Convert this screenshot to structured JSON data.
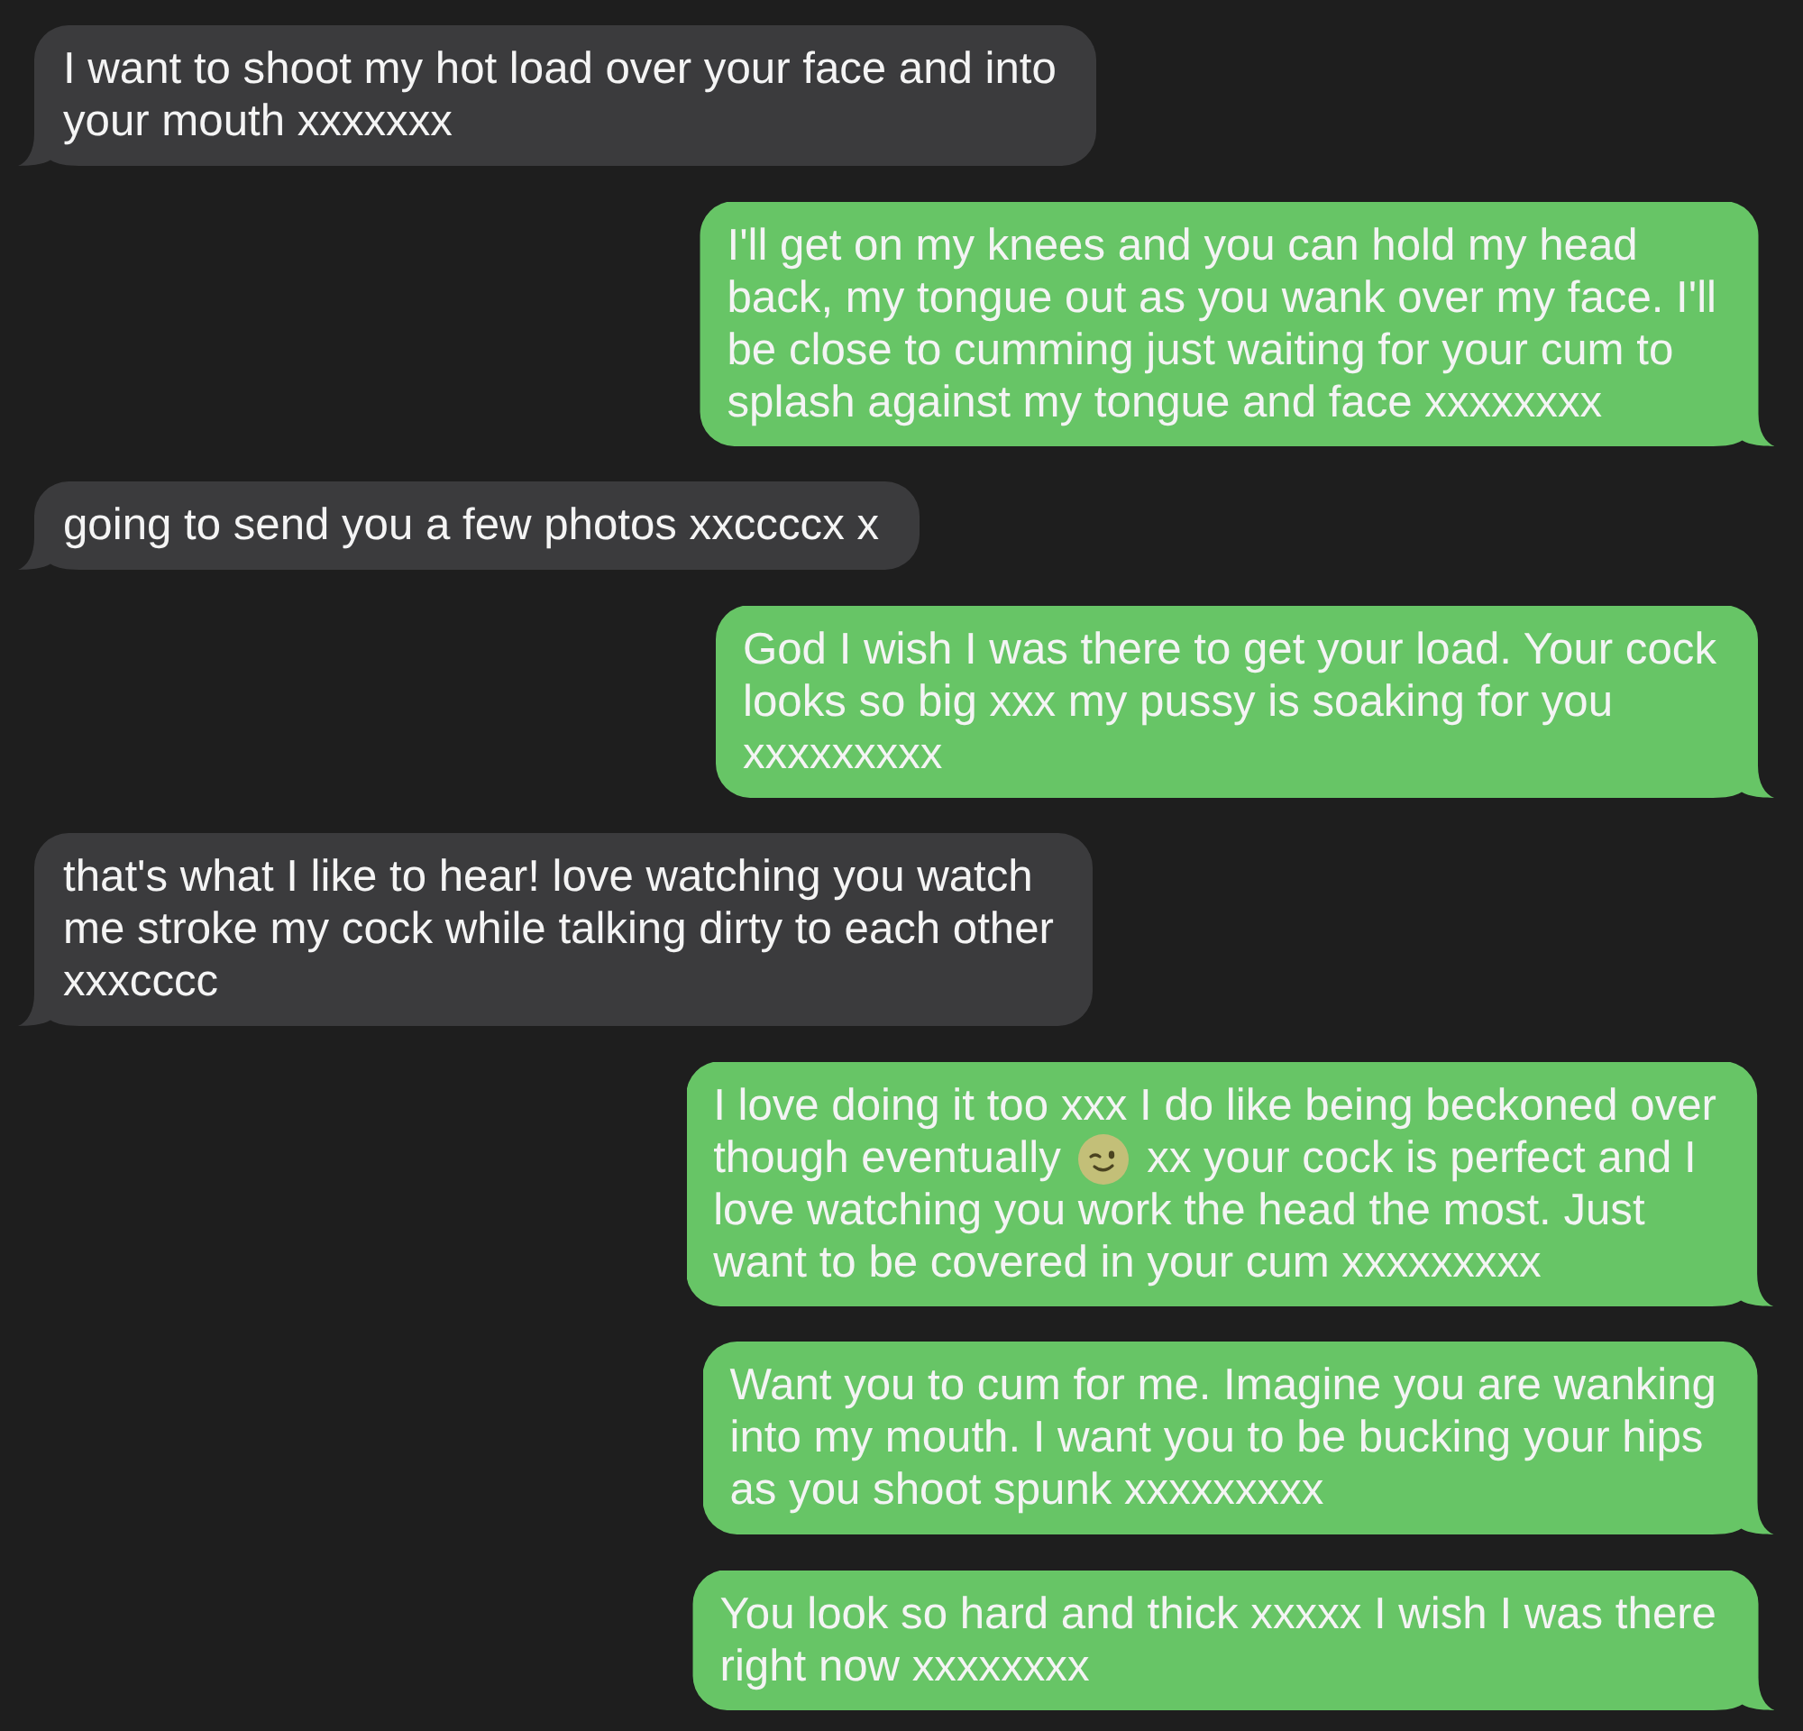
{
  "messages": [
    {
      "kind": "incoming",
      "parts": [
        {
          "kind": "text",
          "text": "I want to shoot my hot load over your face and into\nyour mouth xxxxxxx"
        }
      ]
    },
    {
      "kind": "outgoing",
      "parts": [
        {
          "kind": "text",
          "text": "I'll get on my knees and you can hold my head\nback, my tongue out as you wank over my face. I'll\nbe close to cumming just waiting for your cum to\nsplash against my tongue and face xxxxxxxx"
        }
      ]
    },
    {
      "kind": "incoming",
      "parts": [
        {
          "kind": "text",
          "text": "going to send you a few photos xxccccx x"
        }
      ]
    },
    {
      "kind": "outgoing",
      "parts": [
        {
          "kind": "text",
          "text": "God I wish I was there to get your load. Your cock\nlooks so big xxx my pussy is soaking for you\nxxxxxxxxx"
        }
      ]
    },
    {
      "kind": "incoming",
      "parts": [
        {
          "kind": "text",
          "text": "that's what I like to hear! love watching you watch\nme stroke my cock while talking dirty to each other\nxxxcccc"
        }
      ]
    },
    {
      "kind": "outgoing",
      "parts": [
        {
          "kind": "text",
          "text": "I love doing it too xxx I do like being beckoned over\nthough eventually"
        },
        {
          "kind": "emoji"
        },
        {
          "kind": "text",
          "text": "xx your cock is perfect and I\nlove watching you work the head the most. Just\nwant to be covered in your cum xxxxxxxxx"
        }
      ]
    },
    {
      "kind": "outgoing",
      "parts": [
        {
          "kind": "text",
          "text": "Want you to cum for me. Imagine you are wanking\ninto my mouth. I want you to be bucking your hips\nas you shoot spunk xxxxxxxxx"
        }
      ]
    },
    {
      "kind": "outgoing",
      "parts": [
        {
          "kind": "text",
          "text": "You look so hard and thick xxxxx I wish I was there\nright now xxxxxxxx"
        }
      ]
    }
  ]
}
